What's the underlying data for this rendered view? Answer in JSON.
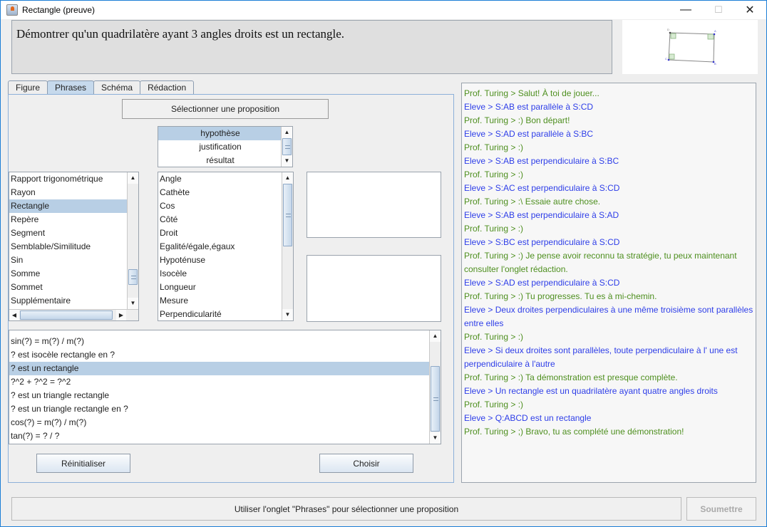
{
  "window": {
    "title": "Rectangle (preuve)",
    "minimize": "—",
    "maximize": "☐",
    "close": "✕"
  },
  "statement": "Démontrer qu'un quadrilatère ayant 3 angles droits est un rectangle.",
  "figure_thumbnail": {
    "vertices": [
      "A",
      "B",
      "C",
      "D"
    ]
  },
  "tabs": [
    {
      "label": "Figure",
      "active": false
    },
    {
      "label": "Phrases",
      "active": true
    },
    {
      "label": "Schéma",
      "active": false
    },
    {
      "label": "Rédaction",
      "active": false
    }
  ],
  "phrases": {
    "select_button": "Sélectionner une proposition",
    "type_list": {
      "items": [
        "hypothèse",
        "justification",
        "résultat"
      ],
      "selected": "hypothèse"
    },
    "concept_list": {
      "items": [
        "Rapport trigonométrique",
        "Rayon",
        "Rectangle",
        "Repère",
        "Segment",
        "Semblable/Similitude",
        "Sin",
        "Somme",
        "Sommet",
        "Supplémentaire"
      ],
      "selected": "Rectangle"
    },
    "concept_list_2": {
      "items": [
        "Angle",
        "Cathète",
        "Cos",
        "Côté",
        "Droit",
        "Egalité/égale,égaux",
        "Hypoténuse",
        "Isocèle",
        "Longueur",
        "Mesure",
        "Perpendicularité"
      ]
    },
    "proposition_list": {
      "items": [
        "sin(?) = m(?) / m(?)",
        "? est isocèle rectangle en ?",
        "? est un rectangle",
        "?^2 + ?^2 = ?^2",
        "? est un triangle rectangle",
        "? est un triangle rectangle en ?",
        "cos(?) = m(?) / m(?)",
        "tan(?) = ? / ?"
      ],
      "selected": "? est un rectangle"
    },
    "reset_button": "Réinitialiser",
    "choose_button": "Choisir"
  },
  "chat": {
    "colors": {
      "prof": "#4e8f1f",
      "eleve": "#2e3ee8"
    },
    "messages": [
      {
        "speaker": "prof",
        "text": "Prof. Turing >  Salut! À toi de jouer..."
      },
      {
        "speaker": "eleve",
        "text": "Eleve >  S:AB est parallèle à S:CD"
      },
      {
        "speaker": "prof",
        "text": "Prof. Turing >  :)  Bon départ!"
      },
      {
        "speaker": "eleve",
        "text": "Eleve >  S:AD est parallèle à S:BC"
      },
      {
        "speaker": "prof",
        "text": "Prof. Turing >  :)"
      },
      {
        "speaker": "eleve",
        "text": "Eleve >  S:AB est perpendiculaire à S:BC"
      },
      {
        "speaker": "prof",
        "text": "Prof. Turing >  :)"
      },
      {
        "speaker": "eleve",
        "text": "Eleve >  S:AC est perpendiculaire à S:CD"
      },
      {
        "speaker": "prof",
        "text": "Prof. Turing >  :\\  Essaie autre chose."
      },
      {
        "speaker": "eleve",
        "text": "Eleve >  S:AB est perpendiculaire à S:AD"
      },
      {
        "speaker": "prof",
        "text": "Prof. Turing >  :)"
      },
      {
        "speaker": "eleve",
        "text": "Eleve >  S:BC est perpendiculaire à S:CD"
      },
      {
        "speaker": "prof",
        "text": "Prof. Turing >  :)  Je pense avoir reconnu ta stratégie, tu peux maintenant consulter l'onglet rédaction."
      },
      {
        "speaker": "eleve",
        "text": "Eleve >  S:AD est perpendiculaire à S:CD"
      },
      {
        "speaker": "prof",
        "text": "Prof. Turing >  :)  Tu progresses. Tu es à mi-chemin."
      },
      {
        "speaker": "eleve",
        "text": "Eleve >  Deux droites perpendiculaires à une même troisième sont parallèles entre elles"
      },
      {
        "speaker": "prof",
        "text": "Prof. Turing >  :)"
      },
      {
        "speaker": "eleve",
        "text": "Eleve >  Si deux droites sont parallèles, toute perpendiculaire à l' une est perpendiculaire à l'autre"
      },
      {
        "speaker": "prof",
        "text": "Prof. Turing >  :)  Ta démonstration est presque complète."
      },
      {
        "speaker": "eleve",
        "text": "Eleve >  Un rectangle est un quadrilatère ayant quatre angles droits"
      },
      {
        "speaker": "prof",
        "text": "Prof. Turing >  :)"
      },
      {
        "speaker": "eleve",
        "text": "Eleve >  Q:ABCD est un rectangle"
      },
      {
        "speaker": "prof",
        "text": "Prof. Turing >  ;)  Bravo, tu as complété une démonstration!"
      }
    ]
  },
  "status_bar": "Utiliser l'onglet \"Phrases\" pour sélectionner une proposition",
  "submit_button": {
    "label": "Soumettre",
    "enabled": false
  }
}
